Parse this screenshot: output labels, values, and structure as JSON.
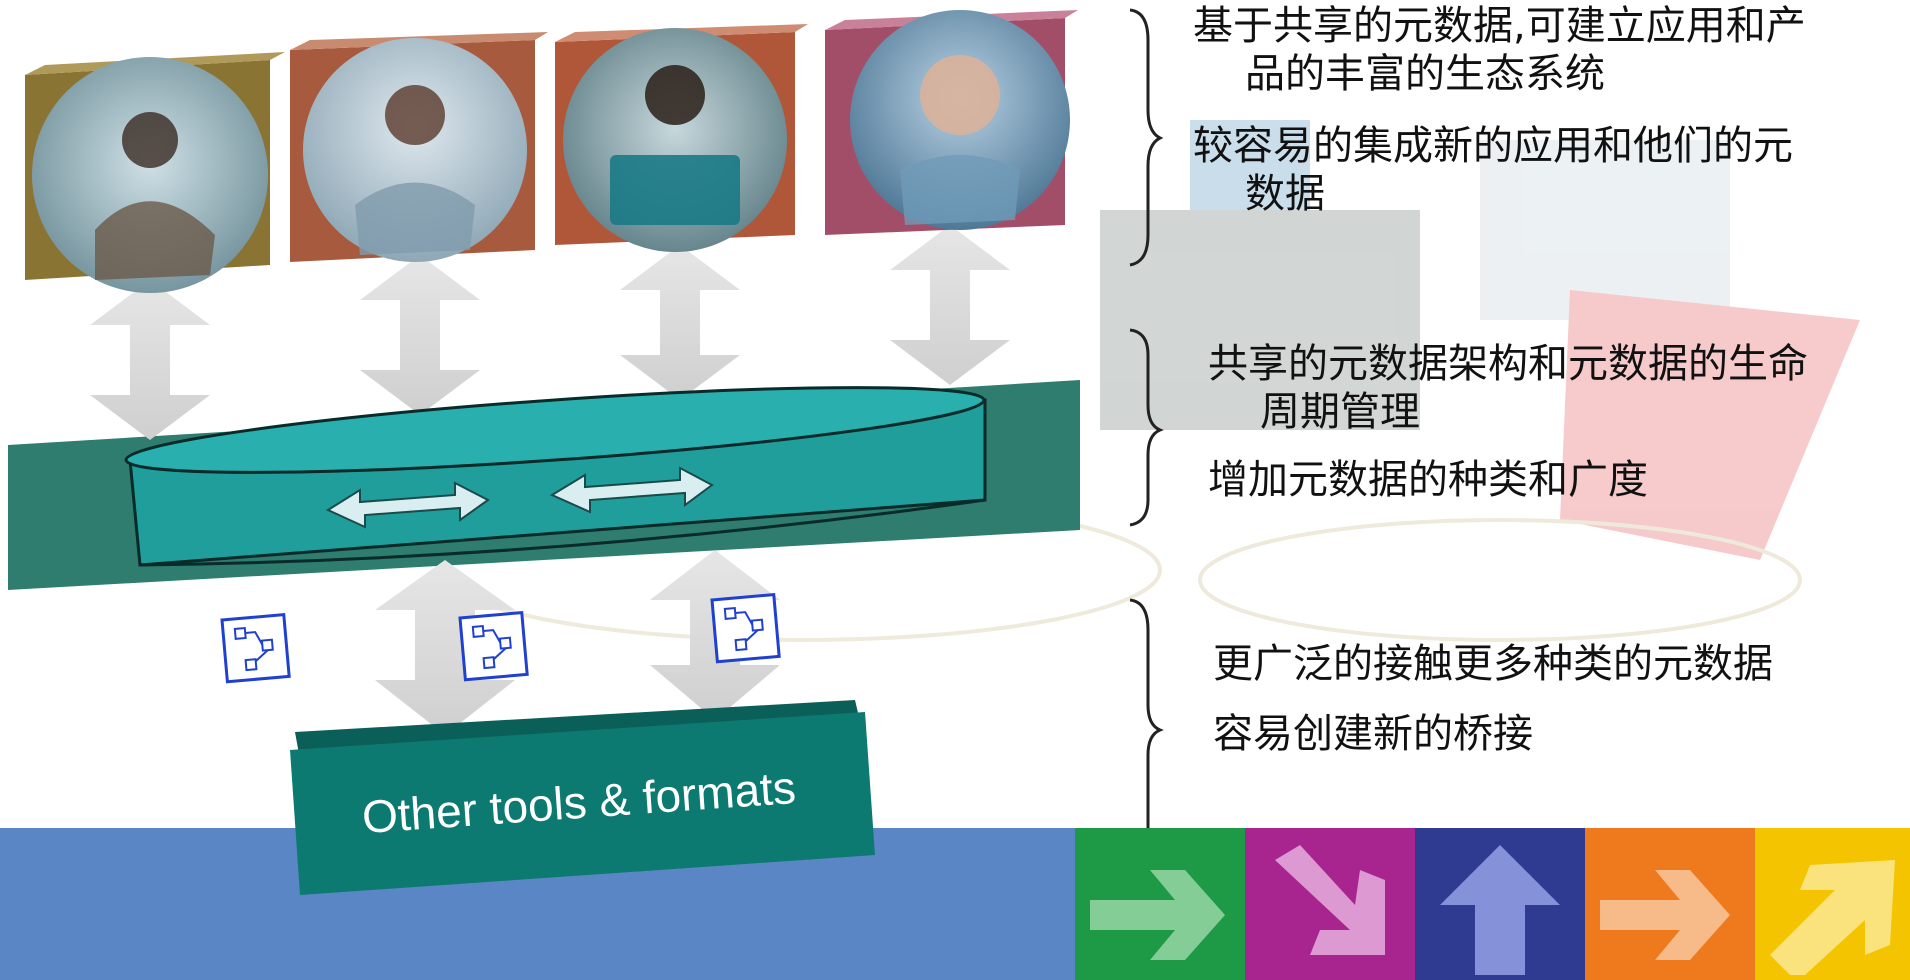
{
  "diagram": {
    "people": [
      {
        "name": "woman-at-desk",
        "bg": "#8a7434"
      },
      {
        "name": "woman-hands-clasped",
        "bg": "#a85a3e"
      },
      {
        "name": "man-with-laptop",
        "bg": "#b0573a"
      },
      {
        "name": "young-man-portrait",
        "bg": "#a34e68"
      }
    ],
    "repository": {
      "color": "#1f9e9c",
      "band_color": "#2e7d6e"
    },
    "tools_box": {
      "label": "Other tools & formats",
      "color": "#0d7a72"
    },
    "bottom_band_color": "#5b86c5",
    "arrow_tiles": [
      {
        "icon": "right-arrow-icon",
        "color": "#1e9a46"
      },
      {
        "icon": "down-right-arrow-icon",
        "color": "#a8258f"
      },
      {
        "icon": "up-arrow-icon",
        "color": "#2f3a91"
      },
      {
        "icon": "right-arrow-icon",
        "color": "#ee7a1d"
      },
      {
        "icon": "up-right-arrow-icon",
        "color": "#f5c400"
      }
    ]
  },
  "bullets": {
    "group1": [
      {
        "line1": "基于共享的元数据,可建立应用和产",
        "line2": "品的丰富的生态系统"
      },
      {
        "line1": "较容易的集成新的应用和他们的元",
        "line2": "数据"
      }
    ],
    "group2": [
      {
        "line1": "共享的元数据架构和元数据的生命",
        "line2": "周期管理"
      },
      {
        "line1": "增加元数据的种类和广度"
      }
    ],
    "group3": [
      {
        "line1": "更广泛的接触更多种类的元数据"
      },
      {
        "line1": "容易创建新的桥接"
      }
    ]
  }
}
